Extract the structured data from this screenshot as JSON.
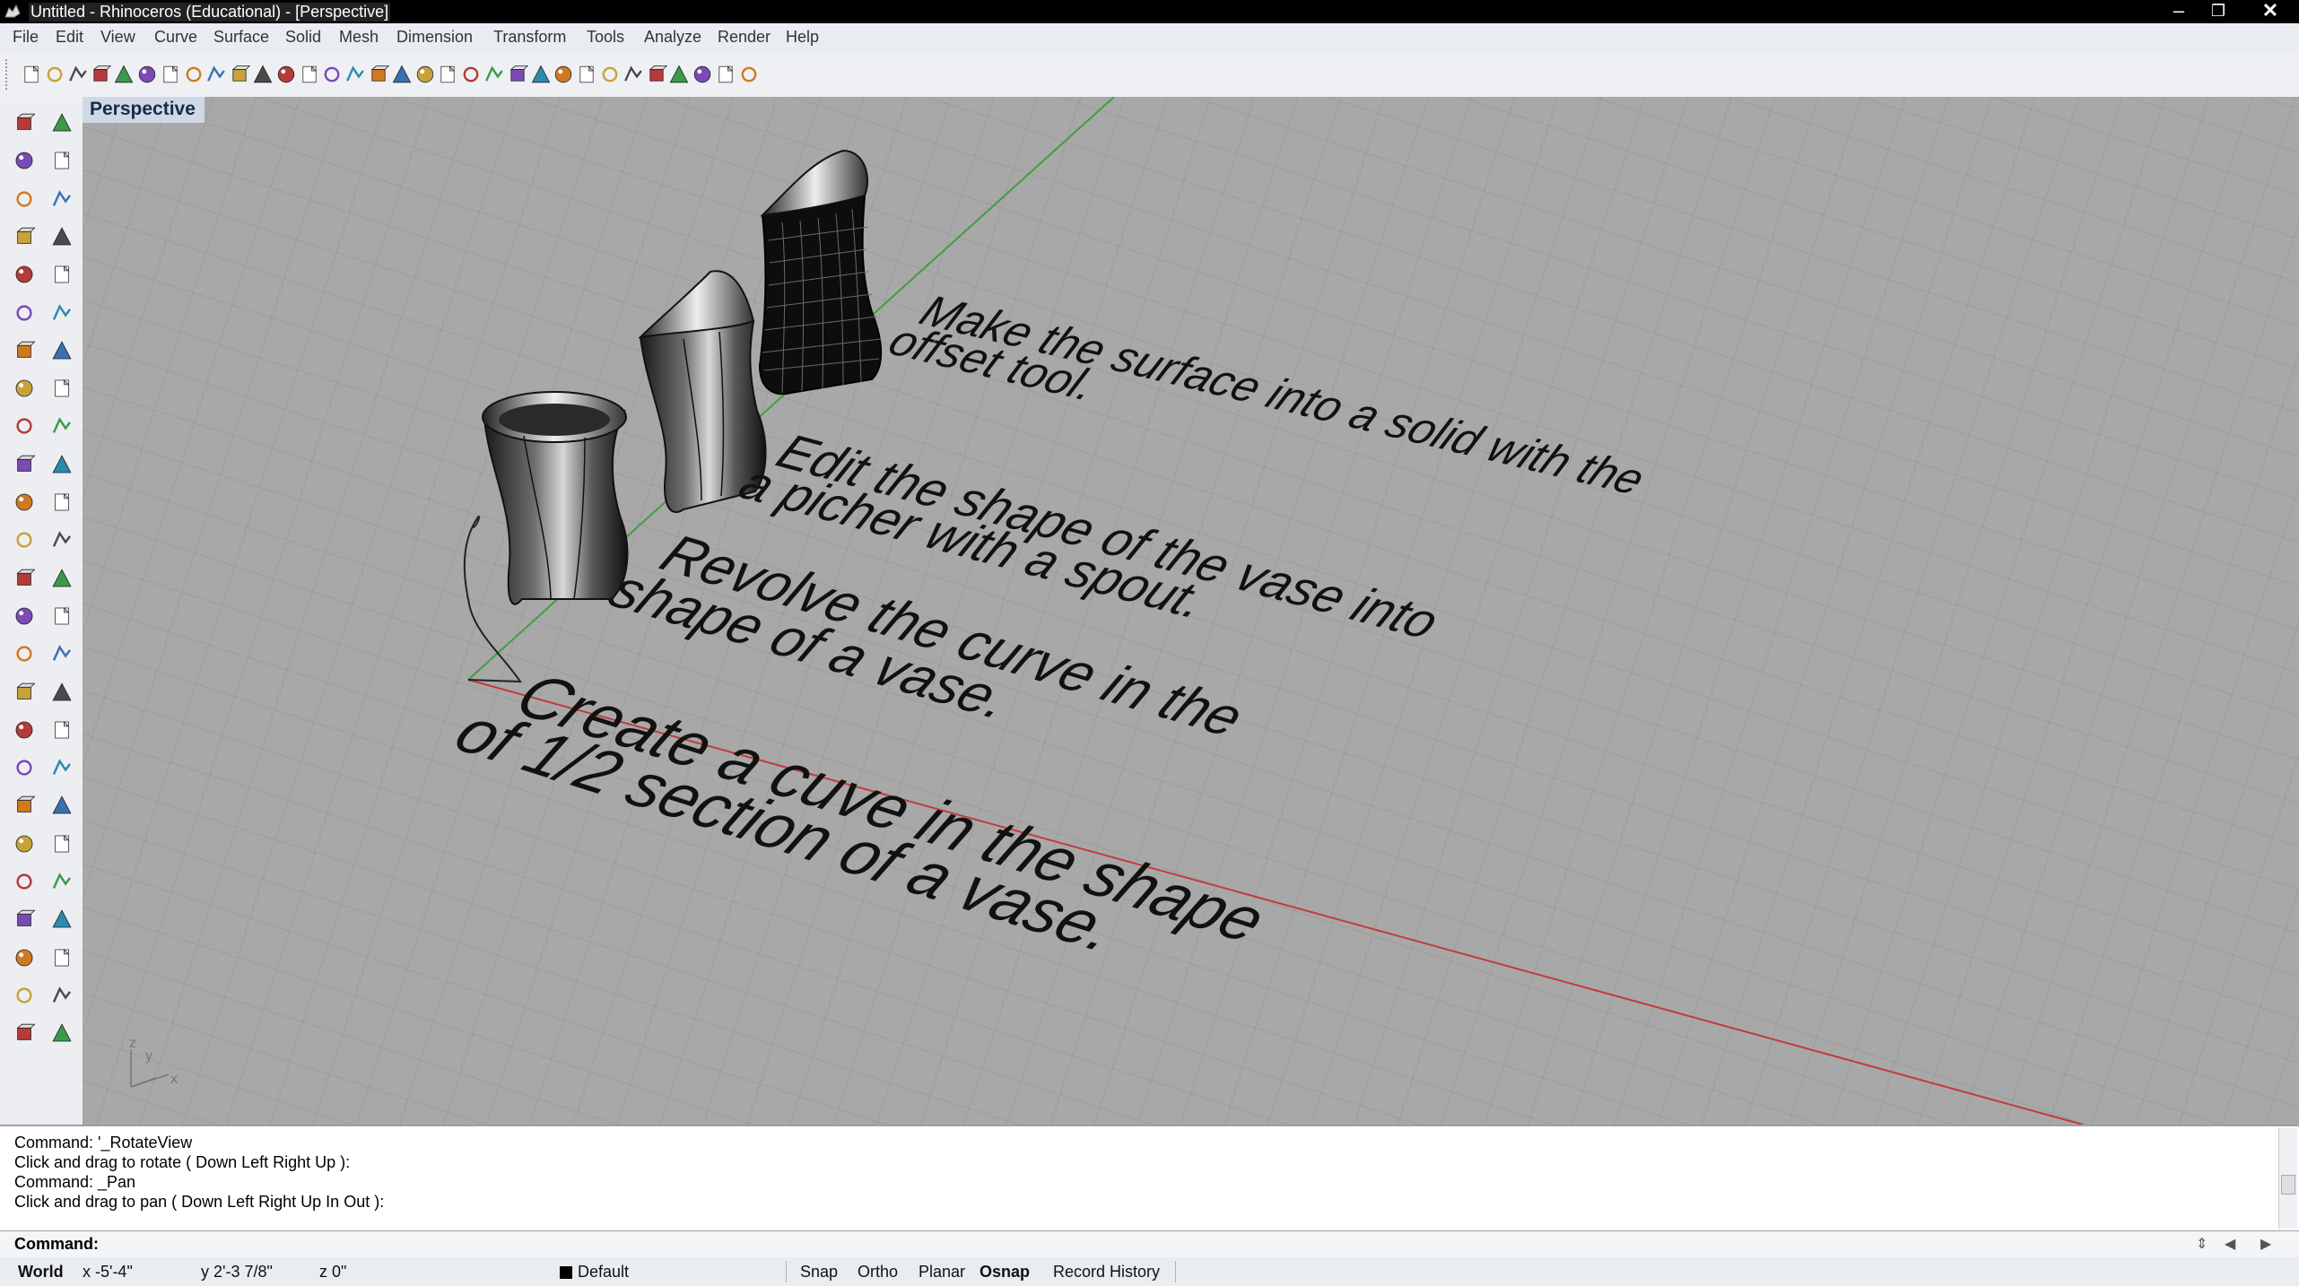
{
  "window": {
    "title": "Untitled - Rhinoceros (Educational) - [Perspective]",
    "app_icon": "rhino-icon",
    "controls": [
      "minimize-icon",
      "restore-icon",
      "close-icon"
    ]
  },
  "menu": [
    "File",
    "Edit",
    "View",
    "Curve",
    "Surface",
    "Solid",
    "Mesh",
    "Dimension",
    "Transform",
    "Tools",
    "Analyze",
    "Render",
    "Help"
  ],
  "toolbar": {
    "buttons": [
      "new-icon",
      "open-icon",
      "save-icon",
      "print-icon",
      "export-icon",
      "cut-icon",
      "copy-icon",
      "paste-icon",
      "undo-icon",
      "pan-hand-icon",
      "rotate-view-icon",
      "zoom-icon",
      "zoom-window-icon",
      "zoom-extents-icon",
      "zoom-selected-icon",
      "undo-view-icon",
      "four-viewports-icon",
      "car-render-icon",
      "ghosted-icon",
      "circle-point-icon",
      "points-icon",
      "light-bulb-icon",
      "lock-icon",
      "layer-color-icon",
      "color-wheel-icon",
      "sphere-wireframe-icon",
      "sphere-mesh-icon",
      "render-sphere-icon",
      "analyze-direction-icon",
      "options-gear-icon",
      "grid-snap-icon",
      "help-icon"
    ]
  },
  "left_toolbar": {
    "buttons": [
      "select-arrow-icon",
      "point-icon",
      "polyline-icon",
      "curve-control-points-icon",
      "circle-icon",
      "ellipse-icon",
      "polygon-icon",
      "rectangle-icon",
      "arc-gear-icon",
      "fillet-curve-icon",
      "surface-corner-icon",
      "loft-icon",
      "box-icon",
      "boolean-union-icon",
      "cylinder-icon",
      "plane-surface-icon",
      "explode-icon",
      "split-icon",
      "trim-icon",
      "extend-icon",
      "join-icon",
      "group-icon",
      "offset-curve-icon",
      "blend-curve-icon",
      "text-icon",
      "dimension-icon",
      "array-icon",
      "edit-point-icon",
      "solid-box-icon",
      "hatch-icon",
      "top-view-icon",
      "front-view-icon",
      "right-view-icon",
      "perspective-view-icon",
      "back-view-icon",
      "left-view-icon",
      "bottom-view-icon",
      "named-view-icon",
      "zoom-view-icon",
      "pan-view-icon",
      "grid-on-icon",
      "grid-off-icon",
      "points-grid-icon",
      "mesh-grid-icon",
      "close-viewport-icon",
      "maximize-viewport-icon",
      "rotate-solid-icon",
      "sweep-solid-icon",
      "revolve-solid-icon",
      "rail-revolve-icon"
    ]
  },
  "viewport": {
    "label": "Perspective",
    "axis_widget": {
      "z": "z",
      "y": "y",
      "x": "x"
    },
    "annotations": [
      {
        "line1": "Make the surface into a solid with the",
        "line2": "offset tool."
      },
      {
        "line1": "Edit the shape of the vase into",
        "line2": "a picher with a spout."
      },
      {
        "line1": "Revolve the curve in the",
        "line2": "shape of a vase."
      },
      {
        "line1": "Create a cuve in the shape",
        "line2": "of 1/2 section of a vase."
      }
    ],
    "axis_colors": {
      "x": "#c43a3a",
      "y": "#3f9e3f"
    },
    "background": "#a8a8a8"
  },
  "command_history": {
    "lines": [
      "Command: '_RotateView",
      "Click and drag to rotate ( Down  Left  Right  Up ):",
      "Command: _Pan",
      "Click and drag to pan ( Down  Left  Right  Up  In  Out ):"
    ]
  },
  "command_line": {
    "prompt": "Command:",
    "value": ""
  },
  "status": {
    "world": "World",
    "x": "x -5'-4\"",
    "y": "y 2'-3 7/8\"",
    "z": "z 0\"",
    "layer": "Default",
    "snap": "Snap",
    "ortho": "Ortho",
    "planar": "Planar",
    "osnap": "Osnap",
    "record_history": "Record History"
  }
}
